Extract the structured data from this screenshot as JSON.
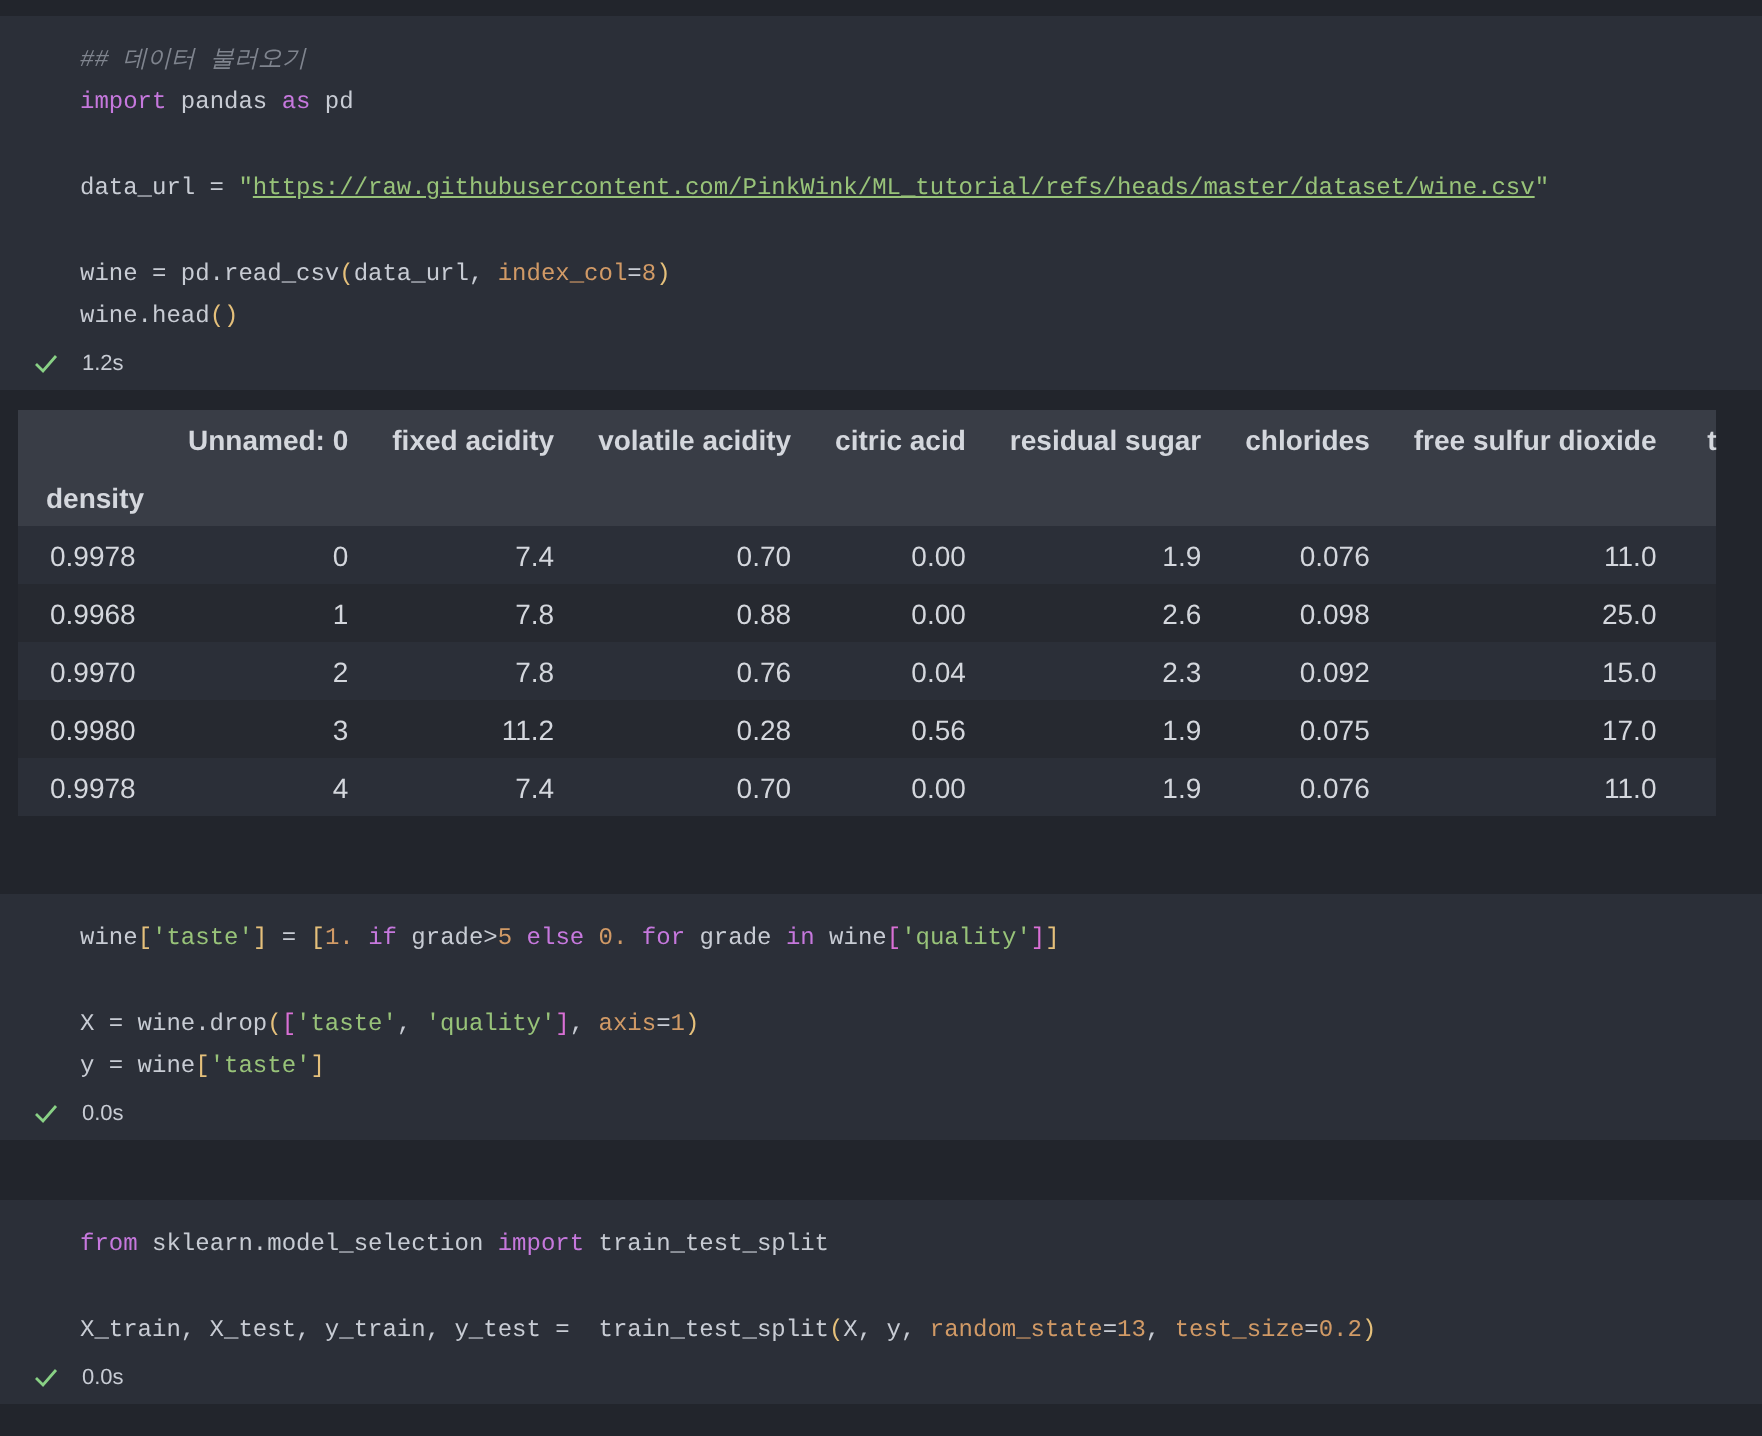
{
  "cells": [
    {
      "lines": [
        {
          "tokens": [
            {
              "t": "## 데이터 불러오기",
              "kind": "comment"
            }
          ]
        },
        {
          "tokens": [
            {
              "t": "import",
              "kind": "keyword"
            },
            {
              "t": " pandas ",
              "kind": "plain"
            },
            {
              "t": "as",
              "kind": "keyword"
            },
            {
              "t": " pd",
              "kind": "plain"
            }
          ]
        },
        {
          "blank": true
        },
        {
          "tokens": [
            {
              "t": "data_url = ",
              "kind": "plain"
            },
            {
              "t": "\"",
              "kind": "string"
            },
            {
              "t": "https://raw.githubusercontent.com/PinkWink/ML_tutorial/refs/heads/master/dataset/wine.csv",
              "kind": "url"
            },
            {
              "t": "\"",
              "kind": "string"
            }
          ]
        },
        {
          "blank": true
        },
        {
          "tokens": [
            {
              "t": "wine = pd.read_csv",
              "kind": "plain"
            },
            {
              "t": "(",
              "kind": "bracket"
            },
            {
              "t": "data_url, ",
              "kind": "plain"
            },
            {
              "t": "index_col",
              "kind": "param"
            },
            {
              "t": "=",
              "kind": "plain"
            },
            {
              "t": "8",
              "kind": "number"
            },
            {
              "t": ")",
              "kind": "bracket"
            }
          ]
        },
        {
          "tokens": [
            {
              "t": "wine.head",
              "kind": "plain"
            },
            {
              "t": "()",
              "kind": "bracket"
            }
          ]
        }
      ],
      "status": {
        "succeeded": true,
        "time": "1.2s"
      },
      "output": {
        "index_name": "density",
        "columns": [
          "Unnamed: 0",
          "fixed acidity",
          "volatile acidity",
          "citric acid",
          "residual sugar",
          "chlorides",
          "free sulfur dioxide",
          "t"
        ],
        "rows": [
          {
            "index": "0.9978",
            "values": [
              "0",
              "7.4",
              "0.70",
              "0.00",
              "1.9",
              "0.076",
              "11.0"
            ]
          },
          {
            "index": "0.9968",
            "values": [
              "1",
              "7.8",
              "0.88",
              "0.00",
              "2.6",
              "0.098",
              "25.0"
            ]
          },
          {
            "index": "0.9970",
            "values": [
              "2",
              "7.8",
              "0.76",
              "0.04",
              "2.3",
              "0.092",
              "15.0"
            ]
          },
          {
            "index": "0.9980",
            "values": [
              "3",
              "11.2",
              "0.28",
              "0.56",
              "1.9",
              "0.075",
              "17.0"
            ]
          },
          {
            "index": "0.9978",
            "values": [
              "4",
              "7.4",
              "0.70",
              "0.00",
              "1.9",
              "0.076",
              "11.0"
            ]
          }
        ]
      }
    },
    {
      "lines": [
        {
          "tokens": [
            {
              "t": "wine",
              "kind": "plain"
            },
            {
              "t": "[",
              "kind": "bracket"
            },
            {
              "t": "'taste'",
              "kind": "string"
            },
            {
              "t": "]",
              "kind": "bracket"
            },
            {
              "t": " = ",
              "kind": "plain"
            },
            {
              "t": "[",
              "kind": "bracket"
            },
            {
              "t": "1. ",
              "kind": "number"
            },
            {
              "t": "if",
              "kind": "keyword"
            },
            {
              "t": " grade>",
              "kind": "plain"
            },
            {
              "t": "5 ",
              "kind": "number"
            },
            {
              "t": "else",
              "kind": "keyword"
            },
            {
              "t": " 0. ",
              "kind": "number"
            },
            {
              "t": "for",
              "kind": "keyword"
            },
            {
              "t": " grade ",
              "kind": "plain"
            },
            {
              "t": "in",
              "kind": "keyword"
            },
            {
              "t": " wine",
              "kind": "plain"
            },
            {
              "t": "[",
              "kind": "bracket2"
            },
            {
              "t": "'quality'",
              "kind": "string"
            },
            {
              "t": "]",
              "kind": "bracket2"
            },
            {
              "t": "]",
              "kind": "bracket"
            }
          ]
        },
        {
          "blank": true
        },
        {
          "tokens": [
            {
              "t": "X = wine.drop",
              "kind": "plain"
            },
            {
              "t": "(",
              "kind": "bracket"
            },
            {
              "t": "[",
              "kind": "bracket2"
            },
            {
              "t": "'taste'",
              "kind": "string"
            },
            {
              "t": ", ",
              "kind": "plain"
            },
            {
              "t": "'quality'",
              "kind": "string"
            },
            {
              "t": "]",
              "kind": "bracket2"
            },
            {
              "t": ", ",
              "kind": "plain"
            },
            {
              "t": "axis",
              "kind": "param"
            },
            {
              "t": "=",
              "kind": "plain"
            },
            {
              "t": "1",
              "kind": "number"
            },
            {
              "t": ")",
              "kind": "bracket"
            }
          ]
        },
        {
          "tokens": [
            {
              "t": "y = wine",
              "kind": "plain"
            },
            {
              "t": "[",
              "kind": "bracket"
            },
            {
              "t": "'taste'",
              "kind": "string"
            },
            {
              "t": "]",
              "kind": "bracket"
            }
          ]
        }
      ],
      "status": {
        "succeeded": true,
        "time": "0.0s"
      }
    },
    {
      "lines": [
        {
          "tokens": [
            {
              "t": "from",
              "kind": "keyword"
            },
            {
              "t": " sklearn.model_selection ",
              "kind": "plain"
            },
            {
              "t": "import",
              "kind": "keyword"
            },
            {
              "t": " train_test_split",
              "kind": "plain"
            }
          ]
        },
        {
          "blank": true
        },
        {
          "tokens": [
            {
              "t": "X_train, X_test, y_train, y_test =  train_test_split",
              "kind": "plain"
            },
            {
              "t": "(",
              "kind": "bracket"
            },
            {
              "t": "X, y, ",
              "kind": "plain"
            },
            {
              "t": "random_state",
              "kind": "param"
            },
            {
              "t": "=",
              "kind": "plain"
            },
            {
              "t": "13",
              "kind": "number"
            },
            {
              "t": ", ",
              "kind": "plain"
            },
            {
              "t": "test_size",
              "kind": "param"
            },
            {
              "t": "=",
              "kind": "plain"
            },
            {
              "t": "0.2",
              "kind": "number"
            },
            {
              "t": ")",
              "kind": "bracket"
            }
          ]
        }
      ],
      "status": {
        "succeeded": true,
        "time": "0.0s"
      }
    }
  ]
}
